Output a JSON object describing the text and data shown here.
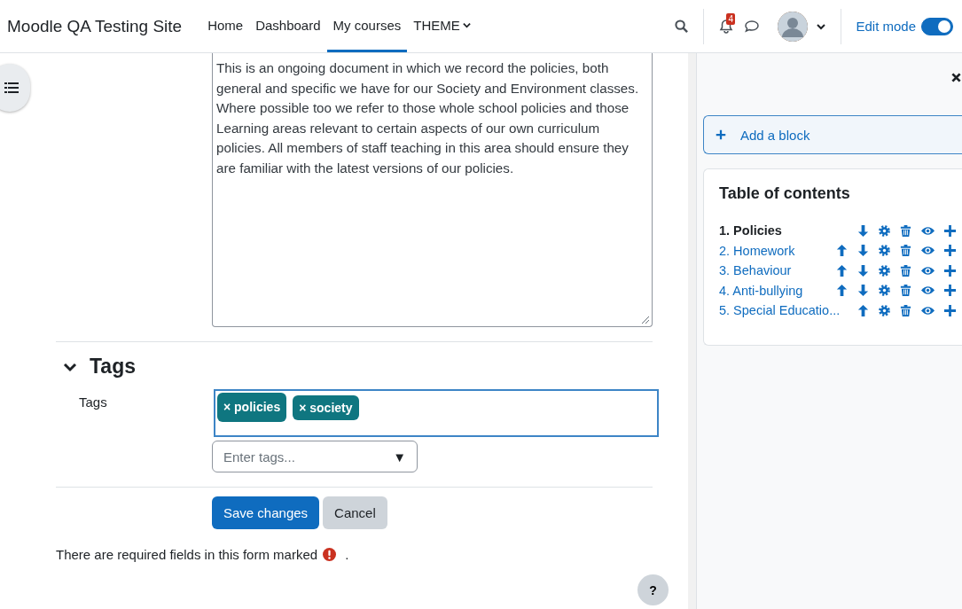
{
  "navbar": {
    "site_name": "Moodle QA Testing Site",
    "nav_items": [
      {
        "label": "Home",
        "selected": false,
        "has_menu": false
      },
      {
        "label": "Dashboard",
        "selected": false,
        "has_menu": false
      },
      {
        "label": "My courses",
        "selected": true,
        "has_menu": false
      },
      {
        "label": "THEME",
        "selected": false,
        "has_menu": true
      }
    ],
    "notification_count": "4",
    "edit_mode": {
      "label": "Edit mode",
      "on": true
    }
  },
  "editor": {
    "text": "This is an ongoing document in which we record the policies, both general and specific we have for our Society and Environment classes. Where possible too we refer to those whole school policies and those Learning areas relevant to certain aspects of our own curriculum policies. All members of staff teaching in this area should ensure they are familiar with the latest versions of our policies."
  },
  "tags_section": {
    "title": "Tags",
    "expanded": true,
    "label": "Tags",
    "tags": [
      "× policies",
      "× society"
    ],
    "placeholder": "Enter tags...",
    "dropdown_arrow": "▼"
  },
  "buttons": [
    {
      "label": "Save changes",
      "kind": "primary"
    },
    {
      "label": "Cancel",
      "kind": "secondary"
    }
  ],
  "required_note": {
    "text": "There are required fields in this form marked",
    "end": "."
  },
  "help_button": "?",
  "drawer": {
    "add_block": "Add a block",
    "toc": {
      "title": "Table of contents",
      "items": [
        {
          "label": "1. Policies",
          "selected": true,
          "actions": [
            {
              "kind": "down"
            },
            {
              "kind": "settings"
            },
            {
              "kind": "delete"
            },
            {
              "kind": "show"
            },
            {
              "kind": "add"
            }
          ]
        },
        {
          "label": "2. Homework",
          "selected": false,
          "actions": [
            {
              "kind": "up"
            },
            {
              "kind": "down"
            },
            {
              "kind": "settings"
            },
            {
              "kind": "delete"
            },
            {
              "kind": "show"
            },
            {
              "kind": "add"
            }
          ]
        },
        {
          "label": "3. Behaviour",
          "selected": false,
          "actions": [
            {
              "kind": "up"
            },
            {
              "kind": "down"
            },
            {
              "kind": "settings"
            },
            {
              "kind": "delete"
            },
            {
              "kind": "show"
            },
            {
              "kind": "add"
            }
          ]
        },
        {
          "label": "4. Anti-bullying",
          "selected": false,
          "actions": [
            {
              "kind": "up"
            },
            {
              "kind": "down"
            },
            {
              "kind": "settings"
            },
            {
              "kind": "delete"
            },
            {
              "kind": "show"
            },
            {
              "kind": "add"
            }
          ]
        },
        {
          "label": "5. Special Educatio...",
          "selected": false,
          "actions": [
            {
              "kind": "up"
            },
            {
              "kind": "settings"
            },
            {
              "kind": "delete"
            },
            {
              "kind": "show"
            },
            {
              "kind": "add"
            }
          ]
        }
      ]
    }
  }
}
